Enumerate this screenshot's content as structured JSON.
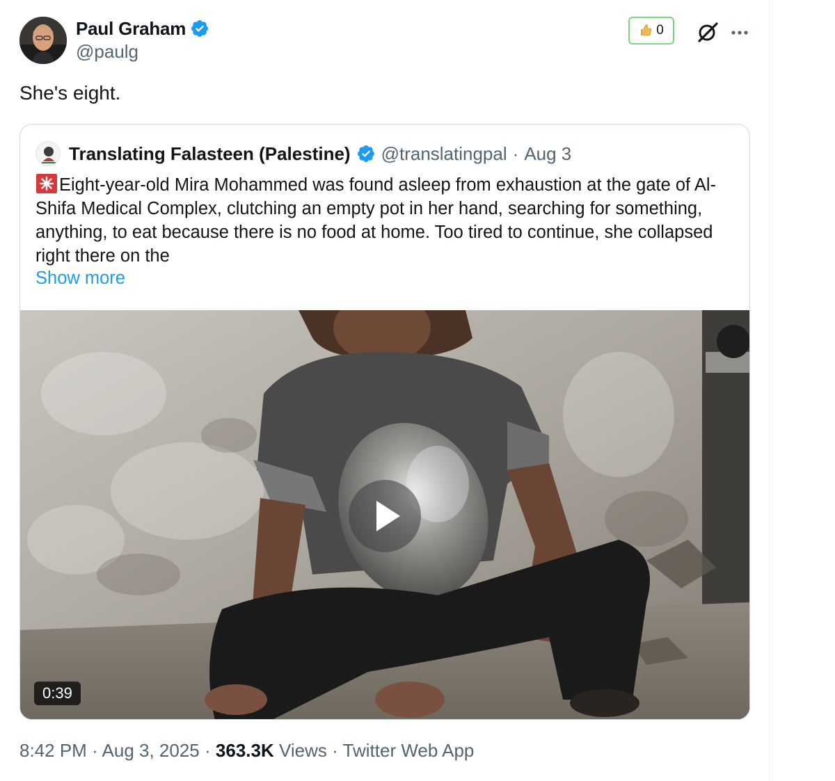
{
  "tweet": {
    "author": {
      "name": "Paul Graham",
      "handle": "@paulg",
      "verified": true
    },
    "text": "She's eight.",
    "reaction": {
      "icon": "thumbs-up-icon",
      "count": "0"
    },
    "actions": {
      "grok_icon": "grok-icon",
      "more_icon": "more-dots-icon"
    },
    "meta": {
      "time": "8:42 PM",
      "date": "Aug 3, 2025",
      "views_count": "363.3K",
      "views_label": "Views",
      "source": "Twitter Web App",
      "separator": "·"
    }
  },
  "quoted": {
    "author": {
      "name": "Translating Falasteen (Palestine)",
      "handle": "@translatingpal",
      "date": "Aug 3",
      "verified": true
    },
    "separator": "·",
    "body": "Eight-year-old Mira Mohammed was found asleep from exhaustion at the gate of Al-Shifa Medical Complex, clutching an empty pot in her hand, searching for something, anything, to eat because there is no food at home. Too tired to continue, she collapsed right there on the",
    "show_more": "Show more",
    "video": {
      "duration": "0:39"
    }
  },
  "colors": {
    "accent_blue": "#1d9bf0",
    "reaction_border": "#7dd67f",
    "secondary_text": "#536471"
  }
}
